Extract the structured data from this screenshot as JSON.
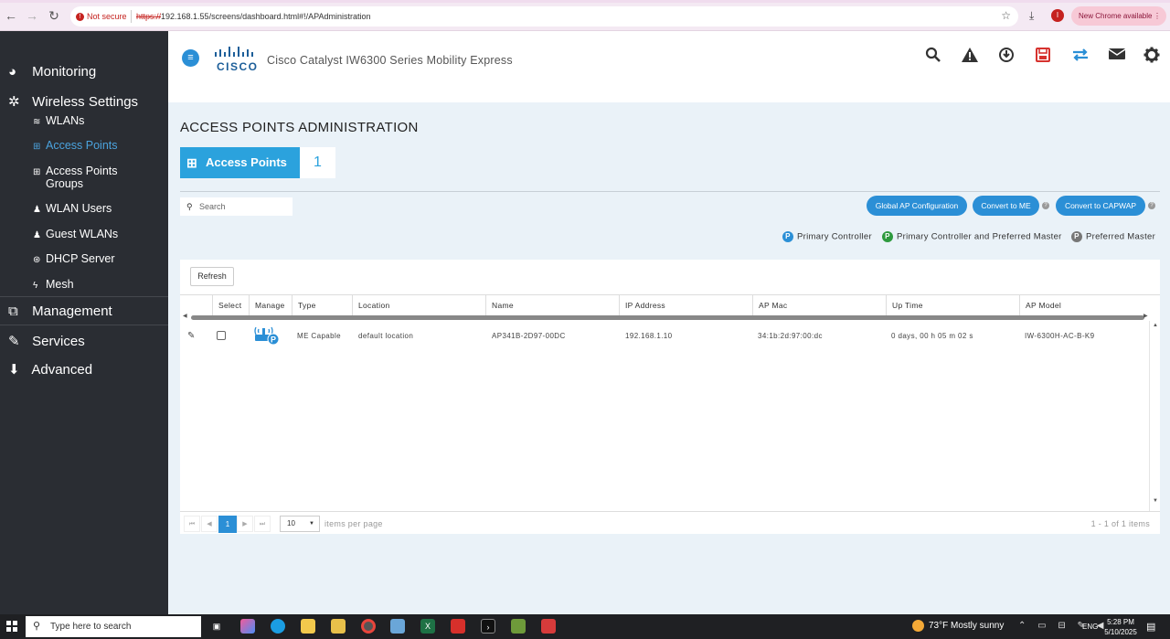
{
  "browser": {
    "not_secure": "Not secure",
    "url_protocol": "https://",
    "url_rest": "192.168.1.55/screens/dashboard.html#!/APAdministration",
    "profile_initial": "I",
    "update_label": "New Chrome available"
  },
  "sidebar": {
    "sections": [
      {
        "label": "Monitoring",
        "icon": "dashboard-icon"
      },
      {
        "label": "Wireless Settings",
        "icon": "gear-icon"
      },
      {
        "label": "Management",
        "icon": "sitemap-icon"
      },
      {
        "label": "Services",
        "icon": "wrench-icon"
      },
      {
        "label": "Advanced",
        "icon": "download-icon"
      }
    ],
    "sub_items": [
      {
        "label": "WLANs",
        "icon": "wifi-icon"
      },
      {
        "label": "Access Points",
        "icon": "access-point-icon",
        "active": true
      },
      {
        "label": "Access Points Groups",
        "icon": "access-point-icon"
      },
      {
        "label": "WLAN Users",
        "icon": "users-icon"
      },
      {
        "label": "Guest WLANs",
        "icon": "users-icon"
      },
      {
        "label": "DHCP Server",
        "icon": "dhcp-icon"
      },
      {
        "label": "Mesh",
        "icon": "bolt-icon"
      }
    ]
  },
  "header": {
    "logo_text": "CISCO",
    "product": "Cisco Catalyst IW6300 Series Mobility Express"
  },
  "main": {
    "title": "ACCESS POINTS ADMINISTRATION",
    "tile_label": "Access Points",
    "tile_count": "1",
    "search_placeholder": "Search",
    "buttons": {
      "global_ap": "Global AP Configuration",
      "convert_me": "Convert to ME",
      "convert_capwap": "Convert to CAPWAP"
    },
    "legend": {
      "primary": "Primary Controller",
      "primary_master": "Primary Controller and Preferred Master",
      "preferred": "Preferred Master"
    },
    "refresh_label": "Refresh",
    "columns": [
      "Select",
      "Manage",
      "Type",
      "Location",
      "Name",
      "IP Address",
      "AP Mac",
      "Up Time",
      "AP Model"
    ],
    "rows": [
      {
        "type": "ME Capable",
        "location": "default location",
        "name": "AP341B-2D97-00DC",
        "ip": "192.168.1.10",
        "mac": "34:1b:2d:97:00:dc",
        "uptime": "0 days, 00 h 05 m 02 s",
        "model": "IW-6300H-AC-B-K9"
      }
    ],
    "pager": {
      "current_page": "1",
      "page_size": "10",
      "per_page_label": "items per page",
      "info": "1 - 1 of 1 items"
    }
  },
  "taskbar": {
    "search_placeholder": "Type here to search",
    "weather": "73°F  Mostly sunny",
    "language": "ENG",
    "time": "5:28 PM",
    "date": "5/10/2025"
  },
  "colors": {
    "accent": "#2b8fd6",
    "tile": "#2ba2dd",
    "sidebar": "#2a2d33",
    "alert_red": "#d6322e",
    "legend_green": "#2e9a3e",
    "legend_gray": "#777777"
  }
}
